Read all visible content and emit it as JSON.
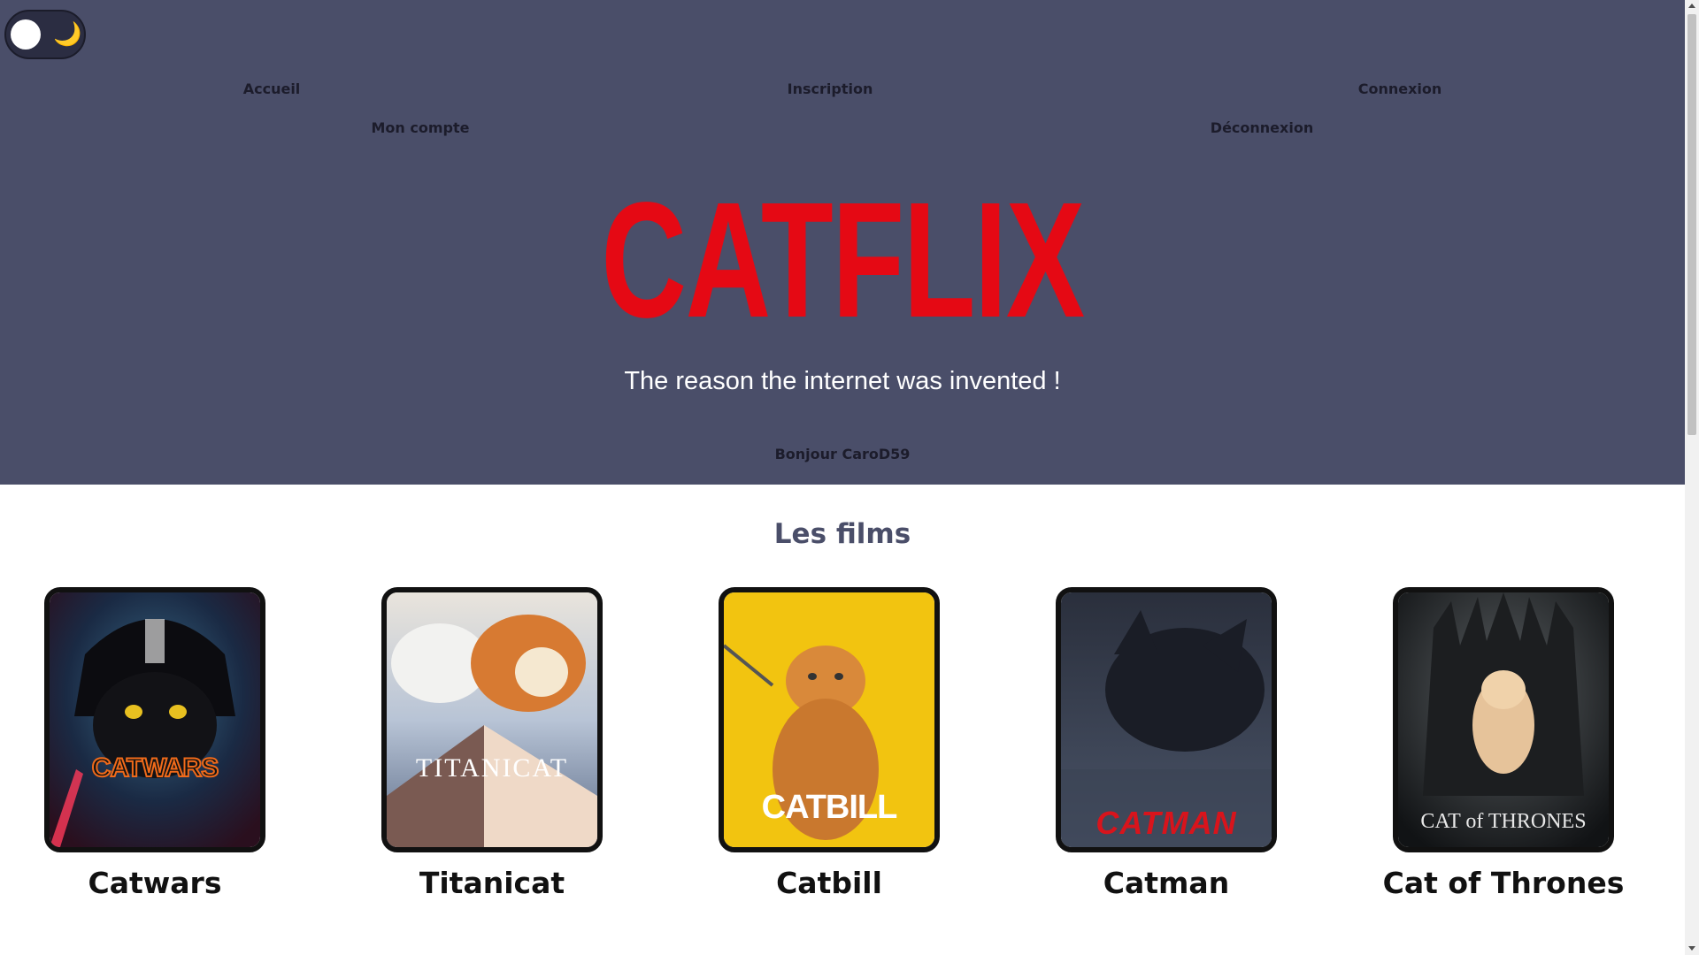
{
  "theme_toggle": {
    "icon": "moon-icon",
    "knob_color": "#ffffff",
    "glyph": "🌙"
  },
  "nav": {
    "home": "Accueil",
    "signup": "Inscription",
    "login": "Connexion",
    "account": "Mon compte",
    "logout": "Déconnexion"
  },
  "hero": {
    "logo": "CATFLIX",
    "tagline": "The reason the internet was invented !",
    "greeting": "Bonjour CaroD59"
  },
  "films_section": {
    "title": "Les films",
    "films": [
      {
        "title": "Catwars",
        "poster_text": "CATWARS"
      },
      {
        "title": "Titanicat",
        "poster_text": "TITANICAT"
      },
      {
        "title": "Catbill",
        "poster_text": "CATBILL"
      },
      {
        "title": "Catman",
        "poster_text": "CATMAN"
      },
      {
        "title": "Cat of Thrones",
        "poster_text": "CAT of THRONES"
      }
    ]
  },
  "colors": {
    "header_bg": "#4a4e69",
    "brand_red": "#e50914",
    "section_title": "#4a4e69"
  }
}
